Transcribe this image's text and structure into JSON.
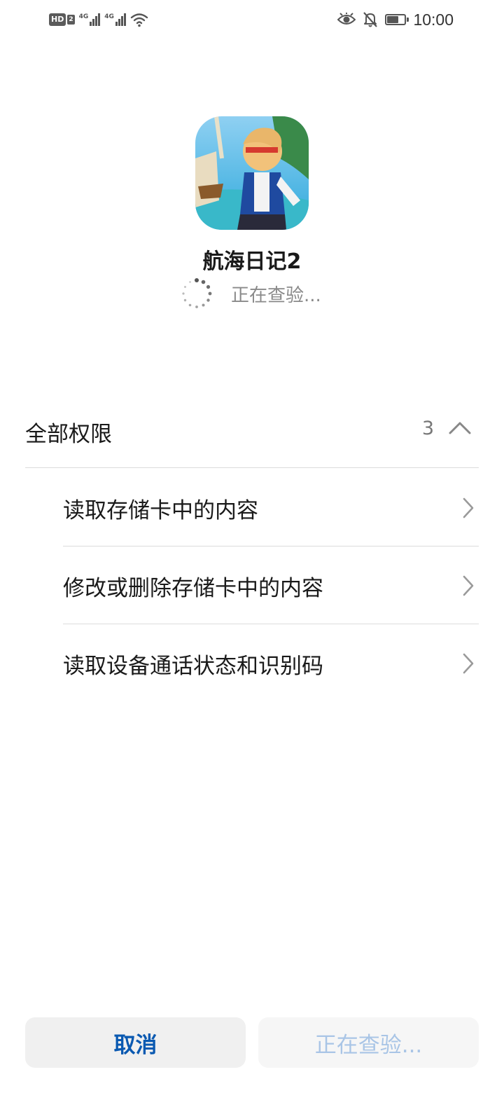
{
  "status_bar": {
    "hd_label": "HD",
    "sim_label": "2",
    "signal_1_tag": "4G",
    "signal_2_tag": "4G",
    "time": "10:00"
  },
  "app": {
    "name": "航海日记2",
    "status_text": "正在查验..."
  },
  "permissions": {
    "title": "全部权限",
    "count": "3",
    "items": [
      {
        "label": "读取存储卡中的内容"
      },
      {
        "label": "修改或删除存储卡中的内容"
      },
      {
        "label": "读取设备通话状态和识别码"
      }
    ]
  },
  "buttons": {
    "cancel_label": "取消",
    "install_label": "正在查验..."
  },
  "colors": {
    "accent": "#0a59b1",
    "disabled_accent": "#a9c5e6",
    "divider": "#dcdcdc"
  }
}
